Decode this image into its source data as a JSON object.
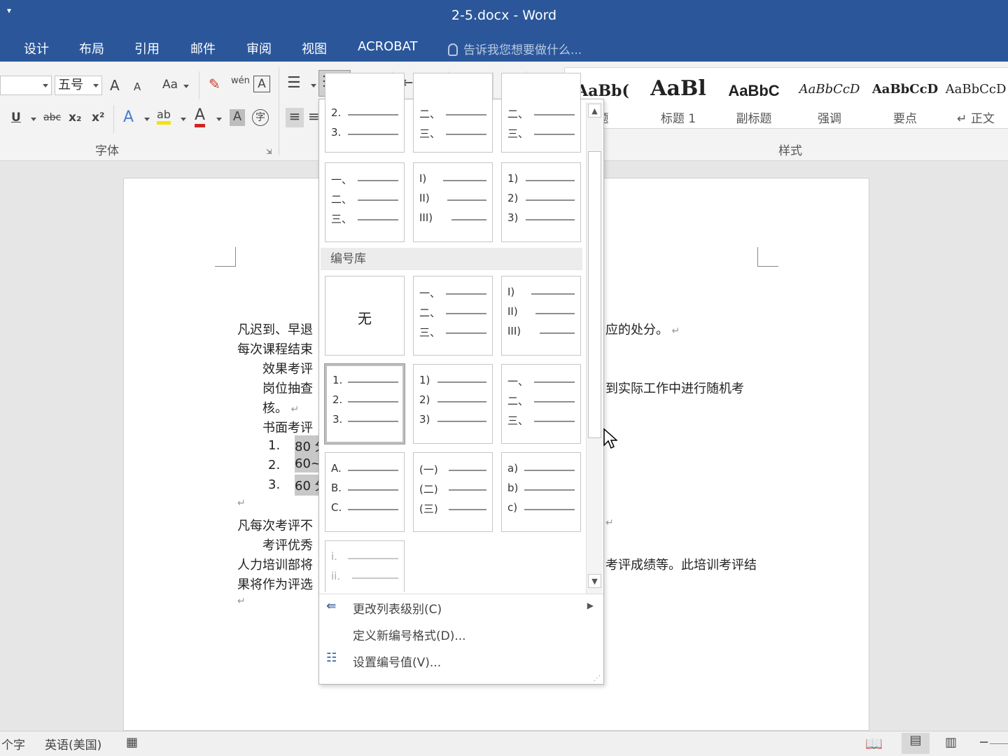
{
  "window": {
    "title": "2-5.docx - Word"
  },
  "tabs": [
    "设计",
    "布局",
    "引用",
    "邮件",
    "审阅",
    "视图",
    "ACROBAT"
  ],
  "tell_me": "告诉我您想要做什么...",
  "ribbon": {
    "font_size": "五号",
    "font_group_label": "字体",
    "styles_group_label": "样式",
    "grow_font": "A",
    "shrink_font": "A",
    "change_case": "Aa",
    "phonetic": "wén",
    "bold_u": "U",
    "strike": "abc",
    "subscript": "x₂",
    "superscript": "x²",
    "text_effects": "A",
    "highlight": "ab",
    "font_color": "A",
    "char_shading": "A",
    "enclose": "字",
    "styles": [
      {
        "sample": "AaBb(",
        "name": "题"
      },
      {
        "sample": "AaBl",
        "name": "标题 1"
      },
      {
        "sample": "AaBbC",
        "name": "副标题"
      },
      {
        "sample": "AaBbCcD",
        "name": "强调"
      },
      {
        "sample": "AaBbCcD",
        "name": "要点"
      },
      {
        "sample": "AaBbCcD",
        "name": "↵ 正文"
      }
    ]
  },
  "document": {
    "lines": [
      "凡迟到、早退",
      "应的处分。",
      "每次课程结束",
      "效果考评",
      "岗位抽查",
      "到实际工作中进行随机考",
      "核。",
      "书面考评",
      "凡每次考评不",
      "考评优秀",
      "人力培训部将",
      "考评成绩等。此培训考评结",
      "果将作为评选"
    ],
    "list": [
      {
        "num": "1.",
        "text": "80 分"
      },
      {
        "num": "2.",
        "text": "60~8"
      },
      {
        "num": "3.",
        "text": "60 分"
      }
    ]
  },
  "numbering_panel": {
    "gallery_label": "编号库",
    "none_label": "无",
    "recent_rows": [
      [
        [
          "2.",
          "3."
        ],
        [
          "二、",
          "三、"
        ],
        [
          "二、",
          "三、"
        ]
      ],
      [
        [
          "一、",
          "二、",
          "三、"
        ],
        [
          "I)",
          "II)",
          "III)"
        ],
        [
          "1)",
          "2)",
          "3)"
        ]
      ]
    ],
    "library_rows": [
      [
        null,
        [
          "一、",
          "二、",
          "三、"
        ],
        [
          "I)",
          "II)",
          "III)"
        ]
      ],
      [
        [
          "1.",
          "2.",
          "3."
        ],
        [
          "1)",
          "2)",
          "3)"
        ],
        [
          "一、",
          "二、",
          "三、"
        ]
      ],
      [
        [
          "A.",
          "B.",
          "C."
        ],
        [
          "(一)",
          "(二)",
          "(三)"
        ],
        [
          "a)",
          "b)",
          "c)"
        ]
      ],
      [
        [
          "i.",
          "ii."
        ]
      ]
    ],
    "menu": [
      {
        "label": "更改列表级别(C)",
        "icon": "change-level-icon"
      },
      {
        "label": "定义新编号格式(D)...",
        "icon": ""
      },
      {
        "label": "设置编号值(V)...",
        "icon": "set-value-icon"
      }
    ]
  },
  "status": {
    "word_count": "个字",
    "language": "英语(美国)"
  },
  "colors": {
    "accent": "#2b579a",
    "ribbon": "#f3f3f3"
  }
}
